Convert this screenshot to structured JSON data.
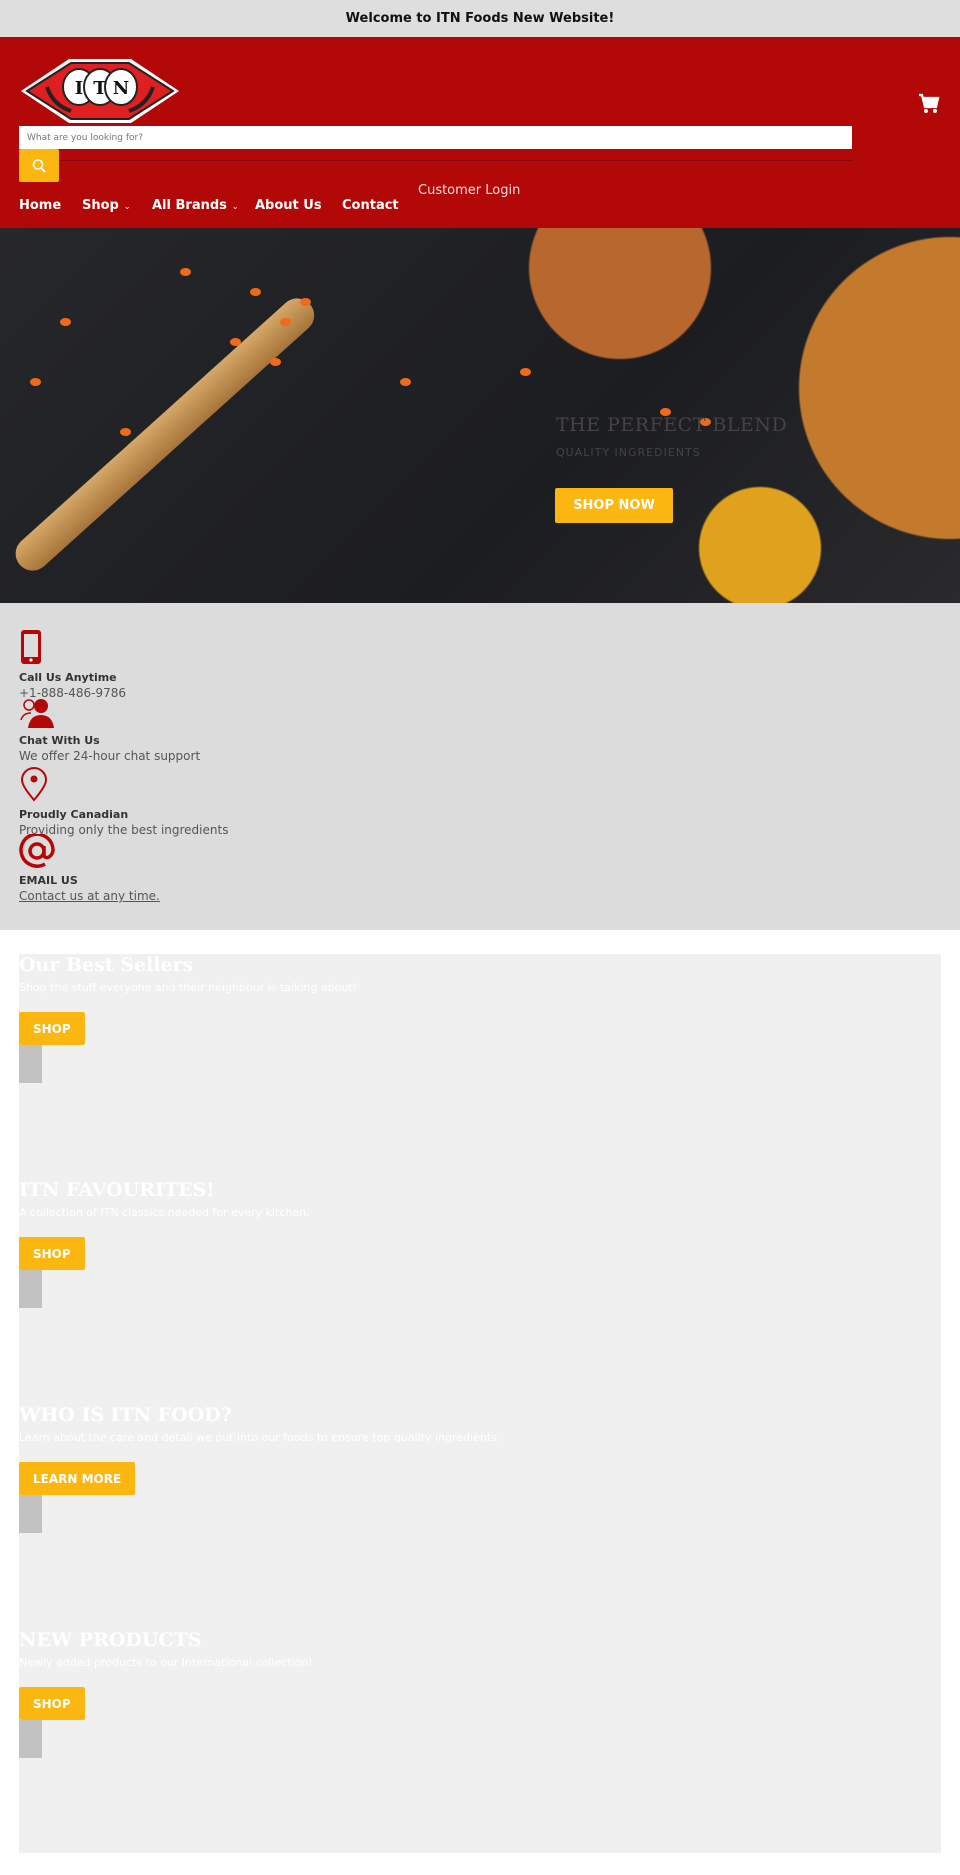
{
  "announcement": "Welcome to ITN Foods New Website!",
  "brand": {
    "logo_text": "ITN",
    "color": "#b30808",
    "accent": "#fbb710"
  },
  "search": {
    "placeholder": "What are you looking for?",
    "button_icon": "search-icon"
  },
  "header": {
    "customer_login": "Customer Login",
    "cart_icon": "cart-icon"
  },
  "nav": [
    {
      "label": "Home"
    },
    {
      "label": "Shop",
      "dropdown": true
    },
    {
      "label": "All Brands",
      "dropdown": true
    },
    {
      "label": "About Us"
    },
    {
      "label": "Contact"
    }
  ],
  "hero": {
    "title": "THE PERFECT BLEND",
    "subtitle": "QUALITY INGREDIENTS",
    "button": "SHOP NOW"
  },
  "features": [
    {
      "icon": "phone-icon",
      "title": "Call Us Anytime",
      "text": "+1-888-486-9786"
    },
    {
      "icon": "users-icon",
      "title": "Chat With Us",
      "text": "We offer 24-hour chat support"
    },
    {
      "icon": "location-pin-icon",
      "title": "Proudly Canadian",
      "text": "Providing only the best ingredients"
    },
    {
      "icon": "at-icon",
      "title": "EMAIL US",
      "text": "Contact us at any time."
    }
  ],
  "sections": [
    {
      "title": "Our Best Sellers",
      "text": "Shop the stuff everyone and their neighbour is talking about!",
      "button": "SHOP"
    },
    {
      "title": "ITN FAVOURITES!",
      "text": "A collection of ITN classics needed for every kitchen.",
      "button": "SHOP"
    },
    {
      "title": "WHO IS ITN FOOD?",
      "text": "Learn about the care and detail we put into our foods to ensure top quality ingredients.",
      "button": "LEARN MORE"
    },
    {
      "title": "NEW PRODUCTS",
      "text": "Newly added products to our  International collection!",
      "button": "SHOP"
    }
  ]
}
